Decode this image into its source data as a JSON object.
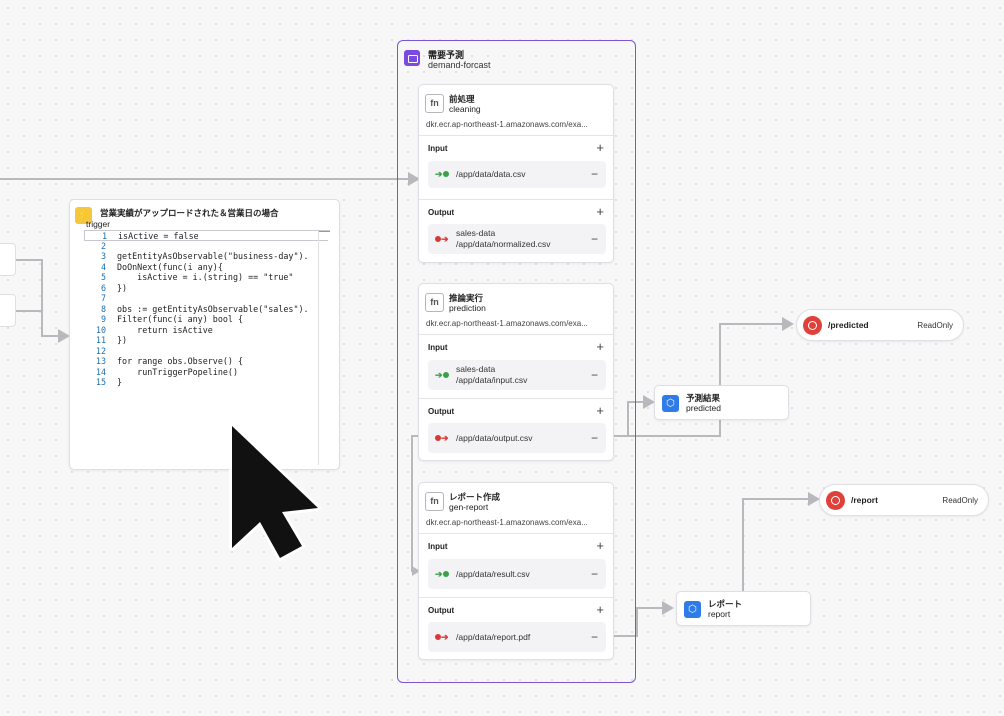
{
  "group": {
    "title": "需要予測",
    "subtitle": "demand-forcast"
  },
  "functions": [
    {
      "title": "前処理",
      "subtitle": "cleaning",
      "image": "dkr.ecr.ap-northeast-1.amazonaws.com/exa...",
      "input_label": "Input",
      "inputs": [
        {
          "name": "",
          "path": "/app/data/data.csv"
        }
      ],
      "output_label": "Output",
      "outputs": [
        {
          "name": "sales-data",
          "path": "/app/data/normalized.csv"
        }
      ]
    },
    {
      "title": "推論実行",
      "subtitle": "prediction",
      "image": "dkr.ecr.ap-northeast-1.amazonaws.com/exa...",
      "input_label": "Input",
      "inputs": [
        {
          "name": "sales-data",
          "path": "/app/data/input.csv"
        }
      ],
      "output_label": "Output",
      "outputs": [
        {
          "name": "",
          "path": "/app/data/output.csv"
        }
      ]
    },
    {
      "title": "レポート作成",
      "subtitle": "gen-report",
      "image": "dkr.ecr.ap-northeast-1.amazonaws.com/exa...",
      "input_label": "Input",
      "inputs": [
        {
          "name": "",
          "path": "/app/data/result.csv"
        }
      ],
      "output_label": "Output",
      "outputs": [
        {
          "name": "",
          "path": "/app/data/report.pdf"
        }
      ]
    }
  ],
  "trigger": {
    "title": "営業実績がアップロードされた＆営業日の場合",
    "subtitle": "trigger",
    "code": [
      {
        "n": "1",
        "text": "isActive = false"
      },
      {
        "n": "2",
        "text": ""
      },
      {
        "n": "3",
        "text": "getEntityAsObservable(\"business-day\")."
      },
      {
        "n": "4",
        "text": "DoOnNext(func(i any){"
      },
      {
        "n": "5",
        "text": "    isActive = i.(string) == \"true\""
      },
      {
        "n": "6",
        "text": "})"
      },
      {
        "n": "7",
        "text": ""
      },
      {
        "n": "8",
        "text": "obs := getEntityAsObservable(\"sales\")."
      },
      {
        "n": "9",
        "text": "Filter(func(i any) bool {"
      },
      {
        "n": "10",
        "text": "    return isActive"
      },
      {
        "n": "11",
        "text": "})"
      },
      {
        "n": "12",
        "text": ""
      },
      {
        "n": "13",
        "text": "for range obs.Observe() {"
      },
      {
        "n": "14",
        "text": "    runTriggerPopeline()"
      },
      {
        "n": "15",
        "text": "}"
      }
    ]
  },
  "results": [
    {
      "title": "予測結果",
      "subtitle": "predicted"
    },
    {
      "title": "レポート",
      "subtitle": "report"
    }
  ],
  "routes": [
    {
      "path": "/predicted",
      "badge": "ReadOnly"
    },
    {
      "path": "/report",
      "badge": "ReadOnly"
    }
  ],
  "symbols": {
    "plus": "+",
    "minus": "−",
    "fn": "fn",
    "trigger_glyph": "⚡"
  },
  "colors": {
    "group_border": "#7b55d6",
    "trigger_icon": "#f4c73d",
    "result_icon": "#2f7be8",
    "route_icon": "#e0403a",
    "input_green": "#3aa04a",
    "output_red": "#d83838"
  }
}
